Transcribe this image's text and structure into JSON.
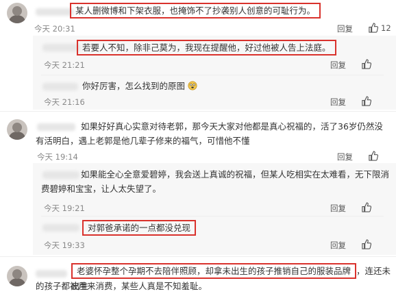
{
  "comments": [
    {
      "text": "某人删微博和下架衣服，也掩饰不了抄袭别人创意的可耻行为。",
      "time": "今天 20:31",
      "reply": "回复",
      "likes": "12"
    },
    {
      "text": "如果好好真心实意对待老郭，那今天大家对他都是真心祝福的，活了36岁仍然没有活明白，遇上老郭是他几辈子修来的福气，可惜他不懂",
      "time": "今天 19:14",
      "reply": "回复"
    },
    {
      "text_hl": "老婆怀孕整个孕期不去陪伴照顾，却拿未出生的孩子推销自己的服装品牌",
      "text_rest_1": "，连还未出生",
      "text_rest_2": "的孩子都被用来消费，某些人真是不知羞耻。"
    }
  ],
  "replies": [
    {
      "text": "若要人不知，除非己莫为，我现在提醒他，好过他被人告上法庭。",
      "time": "今天 21:21",
      "reply": "回复"
    },
    {
      "text": "你好厉害，怎么找到的原图",
      "time": "今天 21:16",
      "reply": "回复"
    },
    {
      "text": "如果能全心全意爱碧婷，我会送上真诚的祝福，但某人吃相实在太难看，无下限消费碧婷和宝宝，让人太失望了。",
      "time": "今天 19:21",
      "reply": "回复"
    },
    {
      "text": "对郭爸承诺的一点都没兑现",
      "time": "今天 19:33",
      "reply": "回复"
    }
  ],
  "icons": {
    "like": "thumb-up-icon",
    "emoji": "face-emoji-icon",
    "avatar": "user-avatar"
  },
  "colors": {
    "highlight_border": "#d9312c",
    "reply_bg": "#f7f7f7",
    "time": "#888888"
  }
}
